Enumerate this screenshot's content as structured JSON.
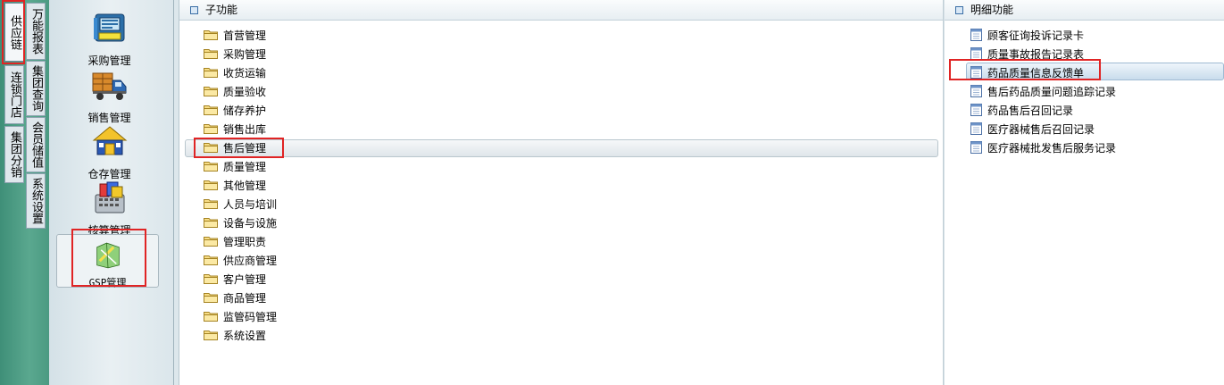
{
  "left_tabs": {
    "outer": [
      {
        "label": "供应链",
        "active": true
      },
      {
        "label": "连锁门店",
        "active": false
      },
      {
        "label": "集团分销",
        "active": false
      }
    ],
    "inner": [
      {
        "label": "万能报表"
      },
      {
        "label": "集团查询"
      },
      {
        "label": "会员储值"
      },
      {
        "label": "系统设置"
      }
    ]
  },
  "modules": [
    {
      "label": "采购管理",
      "icon": "purchase-register-icon"
    },
    {
      "label": "销售管理",
      "icon": "delivery-truck-icon"
    },
    {
      "label": "仓存管理",
      "icon": "warehouse-house-icon"
    },
    {
      "label": "核算管理",
      "icon": "accounting-calculator-icon"
    },
    {
      "label": "GSP管理",
      "icon": "gsp-map-icon",
      "active": true
    }
  ],
  "sub_panel": {
    "title": "子功能",
    "items": [
      {
        "label": "首营管理"
      },
      {
        "label": "采购管理"
      },
      {
        "label": "收货运输"
      },
      {
        "label": "质量验收"
      },
      {
        "label": "储存养护"
      },
      {
        "label": "销售出库"
      },
      {
        "label": "售后管理",
        "selected": true
      },
      {
        "label": "质量管理"
      },
      {
        "label": "其他管理"
      },
      {
        "label": "人员与培训"
      },
      {
        "label": "设备与设施"
      },
      {
        "label": "管理职责"
      },
      {
        "label": "供应商管理"
      },
      {
        "label": "客户管理"
      },
      {
        "label": "商品管理"
      },
      {
        "label": "监管码管理"
      },
      {
        "label": "系统设置"
      }
    ]
  },
  "detail_panel": {
    "title": "明细功能",
    "items": [
      {
        "label": "顾客征询投诉记录卡"
      },
      {
        "label": "质量事故报告记录表"
      },
      {
        "label": "药品质量信息反馈单",
        "selected": true
      },
      {
        "label": "售后药品质量问题追踪记录"
      },
      {
        "label": "药品售后召回记录"
      },
      {
        "label": "医疗器械售后召回记录"
      },
      {
        "label": "医疗器械批发售后服务记录"
      }
    ]
  },
  "colors": {
    "highlight": "#e02424",
    "strip_green": "#4b9a82",
    "folder_yellow": "#f2d36b"
  }
}
